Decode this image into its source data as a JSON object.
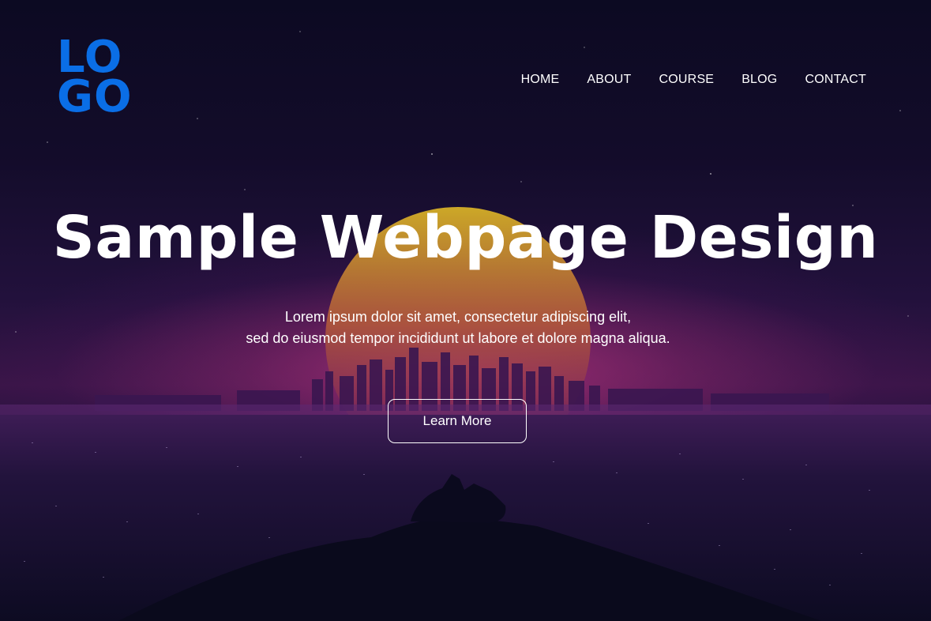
{
  "logo": {
    "line1": "LO",
    "line2": "GO",
    "color": "#0a6ee6"
  },
  "nav": {
    "items": [
      {
        "label": "HOME"
      },
      {
        "label": "ABOUT"
      },
      {
        "label": "COURSE"
      },
      {
        "label": "BLOG"
      },
      {
        "label": "CONTACT"
      }
    ]
  },
  "hero": {
    "title": "Sample Webpage Design",
    "subtitle_line1": "Lorem ipsum dolor sit amet, consectetur adipiscing elit,",
    "subtitle_line2": "sed do eiusmod tempor incididunt ut labore et dolore magna aliqua.",
    "cta_label": "Learn More"
  },
  "theme": {
    "background": "#0b0920",
    "sun_color": "#c8a020",
    "text_color": "#ffffff"
  }
}
